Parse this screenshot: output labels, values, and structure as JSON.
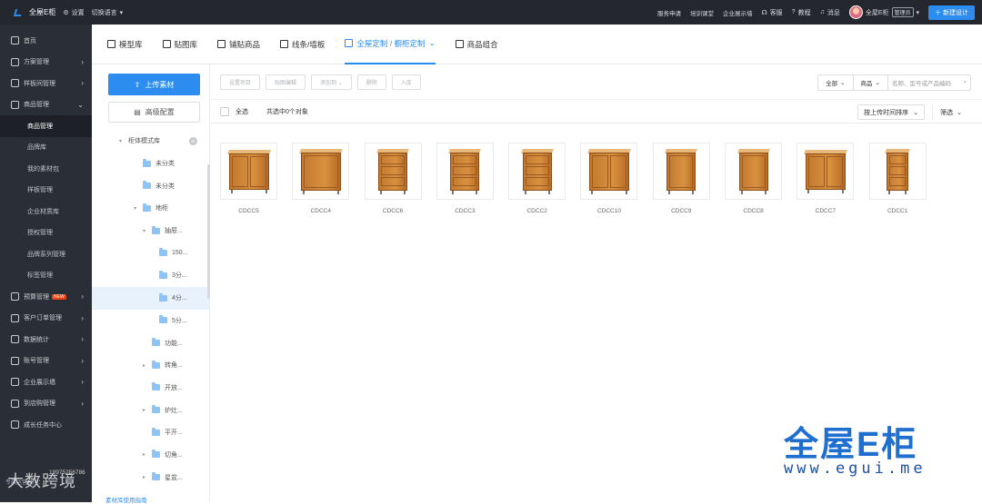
{
  "topbar": {
    "brand": "全屋E柜",
    "settings": "设置",
    "language": "切换语言",
    "links": [
      "服务申请",
      "培训课堂",
      "企业展示墙"
    ],
    "service": "客服",
    "tutorial": "教程",
    "messages": "消息",
    "user": "全屋E柜",
    "role": "管理员",
    "new_design": "新建设计"
  },
  "sidebar": {
    "items": [
      {
        "label": "首页",
        "arrow": ""
      },
      {
        "label": "方案管理",
        "arrow": "›"
      },
      {
        "label": "样板间管理",
        "arrow": "›"
      },
      {
        "label": "商品管理",
        "arrow": "⌄"
      }
    ],
    "sub_items": [
      "商品管理",
      "品牌库",
      "我的素材包",
      "样板管理",
      "企业材质库",
      "授权管理",
      "品牌系列管理",
      "标签管理"
    ],
    "items2": [
      {
        "label": "预算管理",
        "arrow": "›",
        "badge": "NEW"
      },
      {
        "label": "客户订单管理",
        "arrow": "›"
      },
      {
        "label": "数据统计",
        "arrow": "›"
      },
      {
        "label": "账号管理",
        "arrow": "›"
      },
      {
        "label": "企业展示墙",
        "arrow": "›"
      },
      {
        "label": "到店购管理",
        "arrow": "›"
      },
      {
        "label": "成长任务中心",
        "arrow": ""
      }
    ],
    "footer": "专属运营顾问：",
    "phone": "19975256786"
  },
  "tabs": [
    "模型库",
    "贴图库",
    "铺贴商品",
    "线条/墙板",
    "全屋定制 / 橱柜定制",
    "商品组合"
  ],
  "left_panel": {
    "upload": "上传素材",
    "advanced": "高级配置",
    "guide": "素材库使用指南"
  },
  "tree": [
    {
      "label": "柜体模式库",
      "level": 0,
      "caret": "▾",
      "add": true
    },
    {
      "label": "未分类",
      "level": 1,
      "caret": ""
    },
    {
      "label": "未分类",
      "level": 1,
      "caret": ""
    },
    {
      "label": "地柜",
      "level": 1,
      "caret": "▾"
    },
    {
      "label": "抽屉...",
      "level": 2,
      "caret": "▾"
    },
    {
      "label": "150...",
      "level": 3,
      "caret": ""
    },
    {
      "label": "3分...",
      "level": 3,
      "caret": ""
    },
    {
      "label": "4分...",
      "level": 3,
      "caret": "",
      "selected": true
    },
    {
      "label": "5分...",
      "level": 3,
      "caret": ""
    },
    {
      "label": "功能...",
      "level": 2,
      "caret": ""
    },
    {
      "label": "转角...",
      "level": 2,
      "caret": "▸"
    },
    {
      "label": "开放...",
      "level": 2,
      "caret": ""
    },
    {
      "label": "炉灶...",
      "level": 2,
      "caret": "▸"
    },
    {
      "label": "平开...",
      "level": 2,
      "caret": ""
    },
    {
      "label": "切角...",
      "level": 2,
      "caret": "▸"
    },
    {
      "label": "星盆...",
      "level": 2,
      "caret": "▸"
    }
  ],
  "toolbar": {
    "buttons": [
      "设置项目",
      "贴图编辑",
      "添加到 ⌄",
      "删除",
      "入库"
    ],
    "filter1": "全部",
    "filter2": "商品",
    "search_placeholder": "名称、型号或产品编码"
  },
  "list_bar": {
    "select_all": "全选",
    "count": "共选中0个对象",
    "sort": "按上传时间排序",
    "filter": "筛选"
  },
  "products": [
    "CDCC5",
    "CDCC4",
    "CDCC6",
    "CDCC3",
    "CDCC2",
    "CDCC10",
    "CDCC9",
    "CDCC8",
    "CDCC7",
    "CDCC1"
  ],
  "watermark": {
    "logo": "全屋E柜",
    "url": "www.egui.me",
    "left": "大数跨境"
  }
}
